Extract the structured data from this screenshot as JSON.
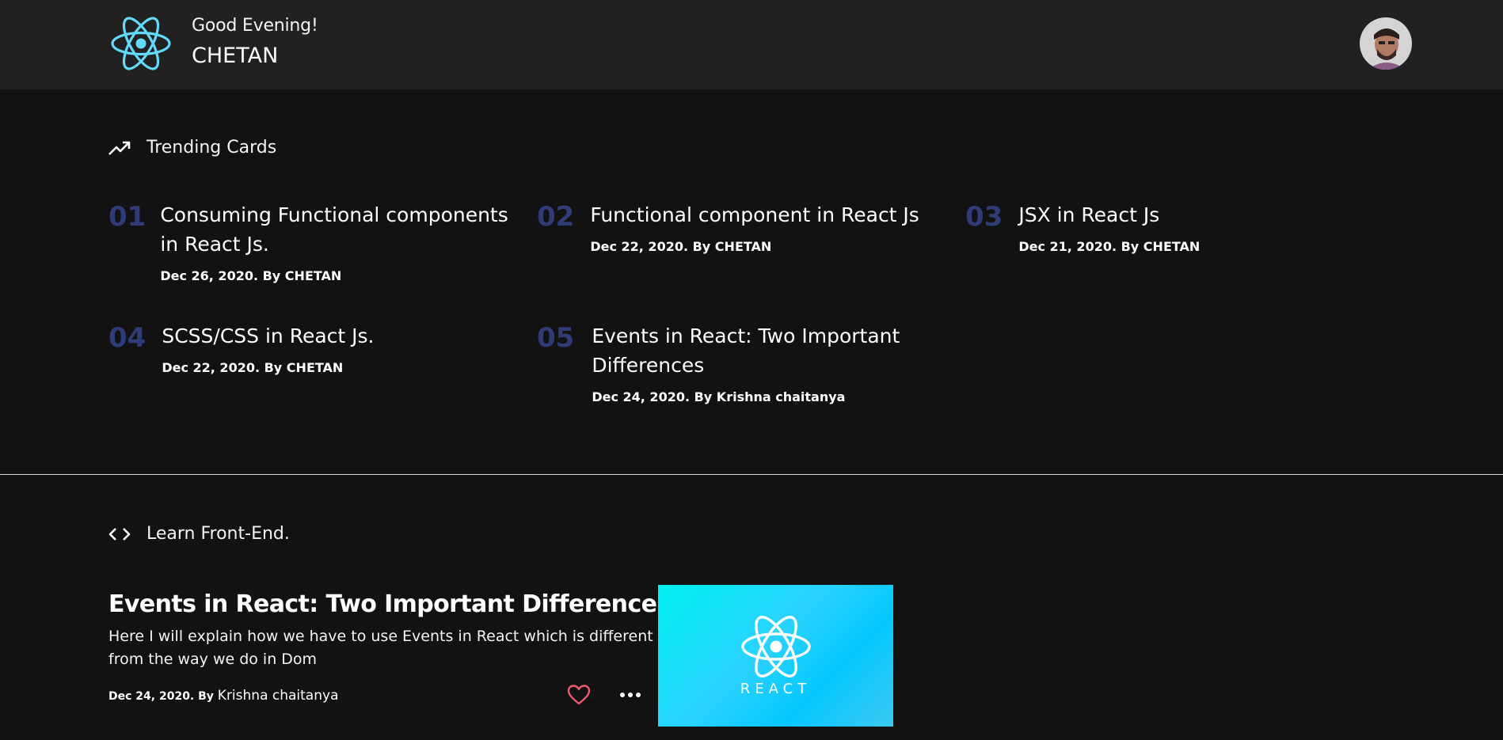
{
  "header": {
    "greeting": "Good Evening!",
    "username": "CHETAN"
  },
  "trending": {
    "heading": "Trending Cards",
    "cards": [
      {
        "num": "01",
        "title_l1": "Consuming Functional components",
        "title_l2": "in React Js.",
        "meta": "Dec 26, 2020. By CHETAN"
      },
      {
        "num": "02",
        "title_l1": "Functional component in React Js",
        "title_l2": "",
        "meta": "Dec 22, 2020. By CHETAN"
      },
      {
        "num": "03",
        "title_l1": "JSX in React Js",
        "title_l2": "",
        "meta": "Dec 21, 2020. By CHETAN"
      },
      {
        "num": "04",
        "title_l1": "SCSS/CSS in React Js.",
        "title_l2": "",
        "meta": "Dec 22, 2020. By CHETAN"
      },
      {
        "num": "05",
        "title_l1": "Events in React: Two Important",
        "title_l2": "Differences",
        "meta": "Dec 24, 2020. By Krishna chaitanya"
      }
    ]
  },
  "learn": {
    "heading": "Learn Front-End.",
    "article": {
      "title": "Events in React: Two Important Differences",
      "description": "Here I will explain how we have to use Events in React which is different from the way we do in Dom",
      "date": "Dec 24, 2020. By",
      "author": "Krishna chaitanya",
      "thumb_word": "REACT"
    }
  },
  "colors": {
    "background": "#121212",
    "header_bg": "#212121",
    "number_accent": "#2f3c77",
    "react_logo": "#61dafb",
    "heart": "#f05a6e"
  },
  "icons": {
    "logo": "react-atom-icon",
    "trending": "trending-up-icon",
    "learn": "code-brackets-icon",
    "like": "heart-icon",
    "more": "more-dots-icon"
  }
}
